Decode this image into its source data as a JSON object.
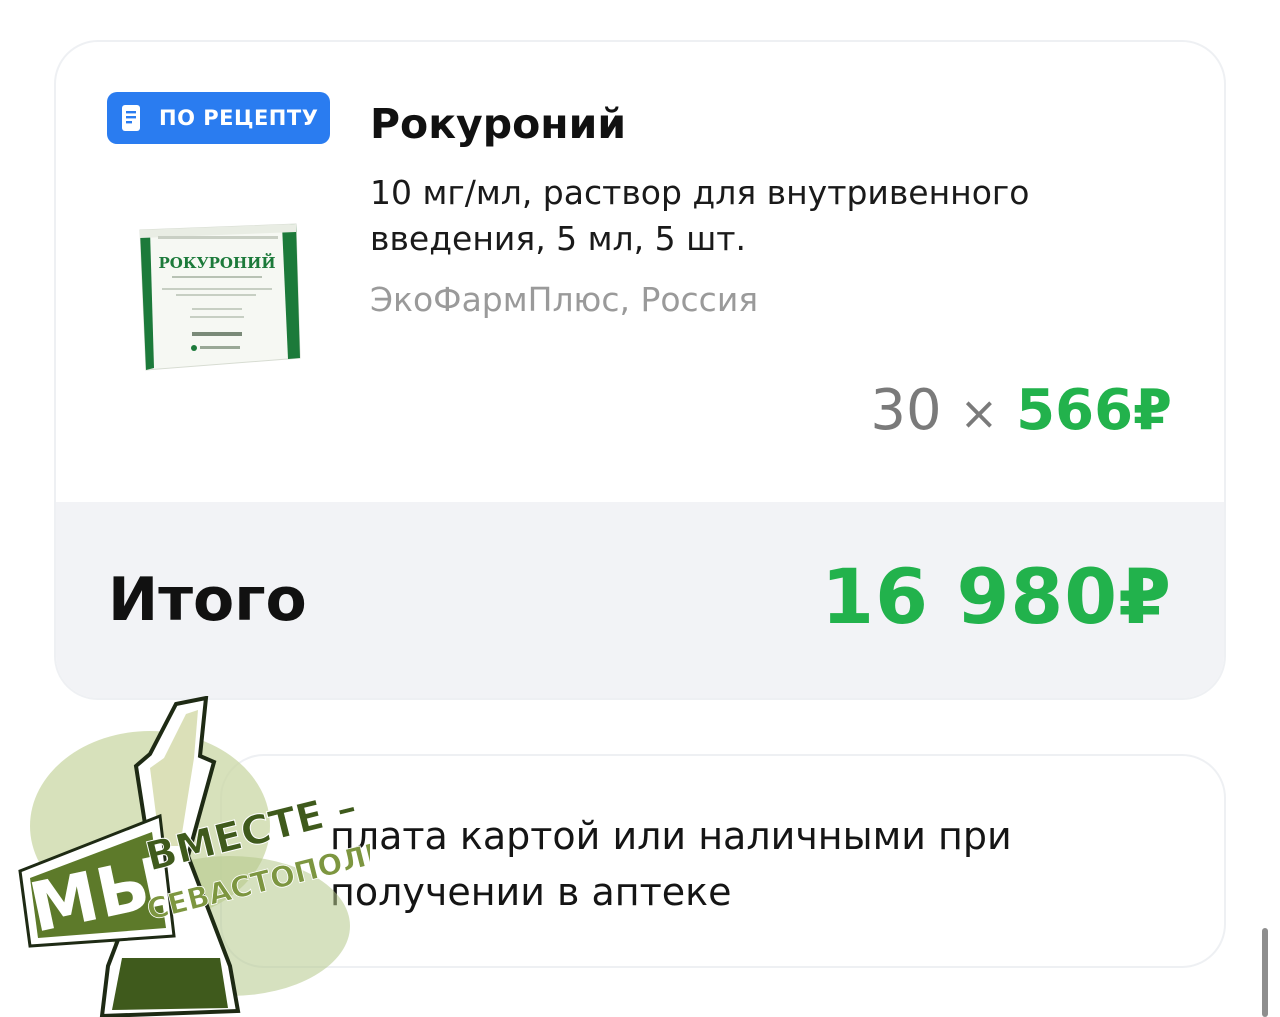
{
  "order_item": {
    "badge_label": "ПО РЕЦЕПТУ",
    "badge_icon": "receipt-icon",
    "product_name": "Рокуроний",
    "description": "10 мг/мл, раствор для внутривенного введения, 5 мл, 5 шт.",
    "manufacturer": "ЭкоФармПлюс, Россия",
    "package_label": "РОКУРОНИЙ",
    "quantity": "30",
    "multiply_sign": "×",
    "unit_price": "566₽"
  },
  "total": {
    "label": "Итого",
    "value": "16 980₽"
  },
  "payment": {
    "text": "плата картой или наличными при получении в аптеке"
  },
  "watermark": {
    "line1": "МЫ",
    "line2": "ВМЕСТЕ –",
    "line3": "СЕВАСТОПОЛЬ"
  },
  "colors": {
    "accent_green": "#22b24c",
    "badge_blue": "#2a7cf0",
    "total_bg": "#f2f3f6",
    "muted_text": "#9a9a9a"
  }
}
